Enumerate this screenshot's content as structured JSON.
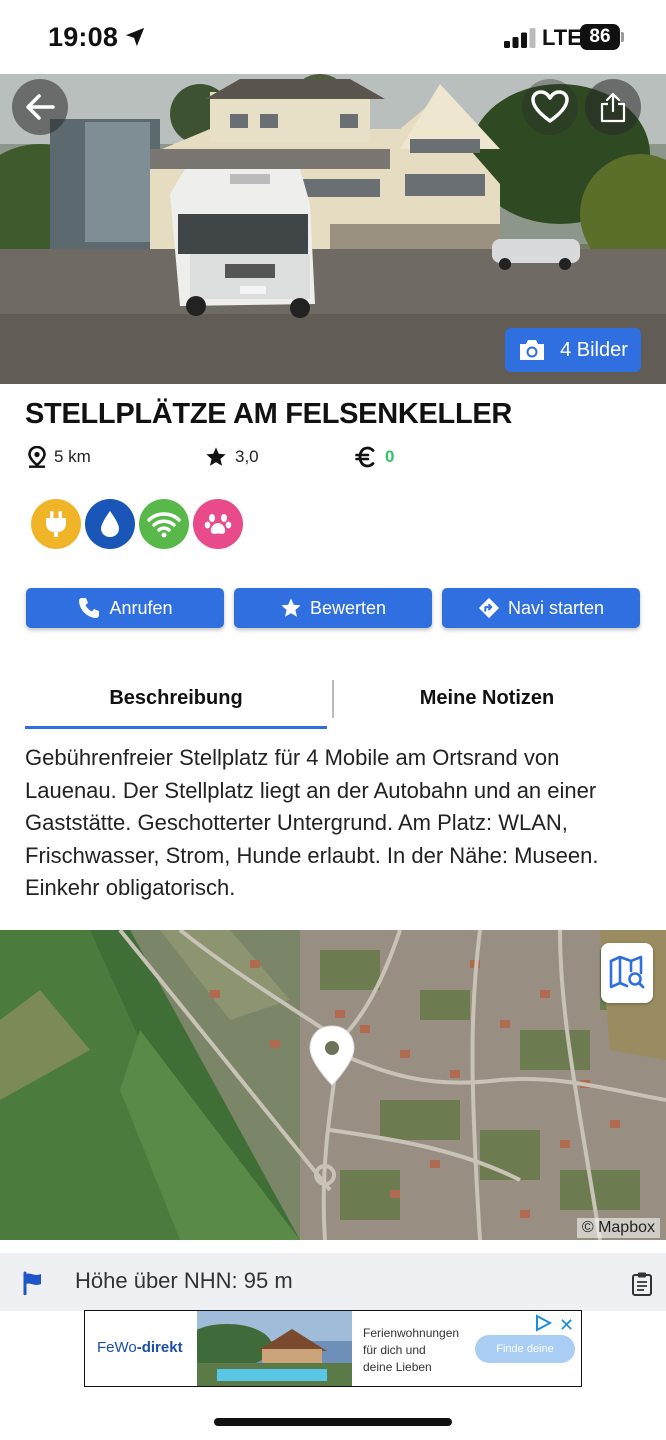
{
  "status_bar": {
    "time": "19:08",
    "network": "LTE",
    "battery": "86"
  },
  "hero": {
    "photos_label": "4 Bilder"
  },
  "place": {
    "title": "STELLPLÄTZE AM FELSENKELLER",
    "distance": "5 km",
    "rating": "3,0",
    "price": "0"
  },
  "amenities": [
    {
      "name": "power-icon",
      "color": "#f0b429"
    },
    {
      "name": "water-icon",
      "color": "#1a56b8"
    },
    {
      "name": "wifi-icon",
      "color": "#58b84a"
    },
    {
      "name": "pets-icon",
      "color": "#e84a8a"
    }
  ],
  "actions": {
    "call": "Anrufen",
    "rate": "Bewerten",
    "navigate": "Navi starten"
  },
  "tabs": {
    "description": "Beschreibung",
    "notes": "Meine Notizen"
  },
  "description": "Gebührenfreier Stellplatz  für 4 Mobile am Ortsrand von Lauenau. Der Stellplatz liegt an der Autobahn und an einer Gaststätte. Geschotterter Untergrund. Am Platz: WLAN, Frischwasser, Strom, Hunde erlaubt. In der Nähe: Museen. Einkehr obligatorisch.",
  "map": {
    "attribution": "© Mapbox"
  },
  "altitude": "Höhe über NHN: 95 m",
  "ad": {
    "brand_a": "FeWo",
    "brand_b": "-direkt",
    "line_1": "Ferienwohnungen",
    "line_2": "für dich und",
    "line_3": "deine Lieben",
    "cta": "Finde deine",
    "close": "✕"
  },
  "colors": {
    "primary": "#2f6fe0",
    "price": "#2ec46a"
  }
}
